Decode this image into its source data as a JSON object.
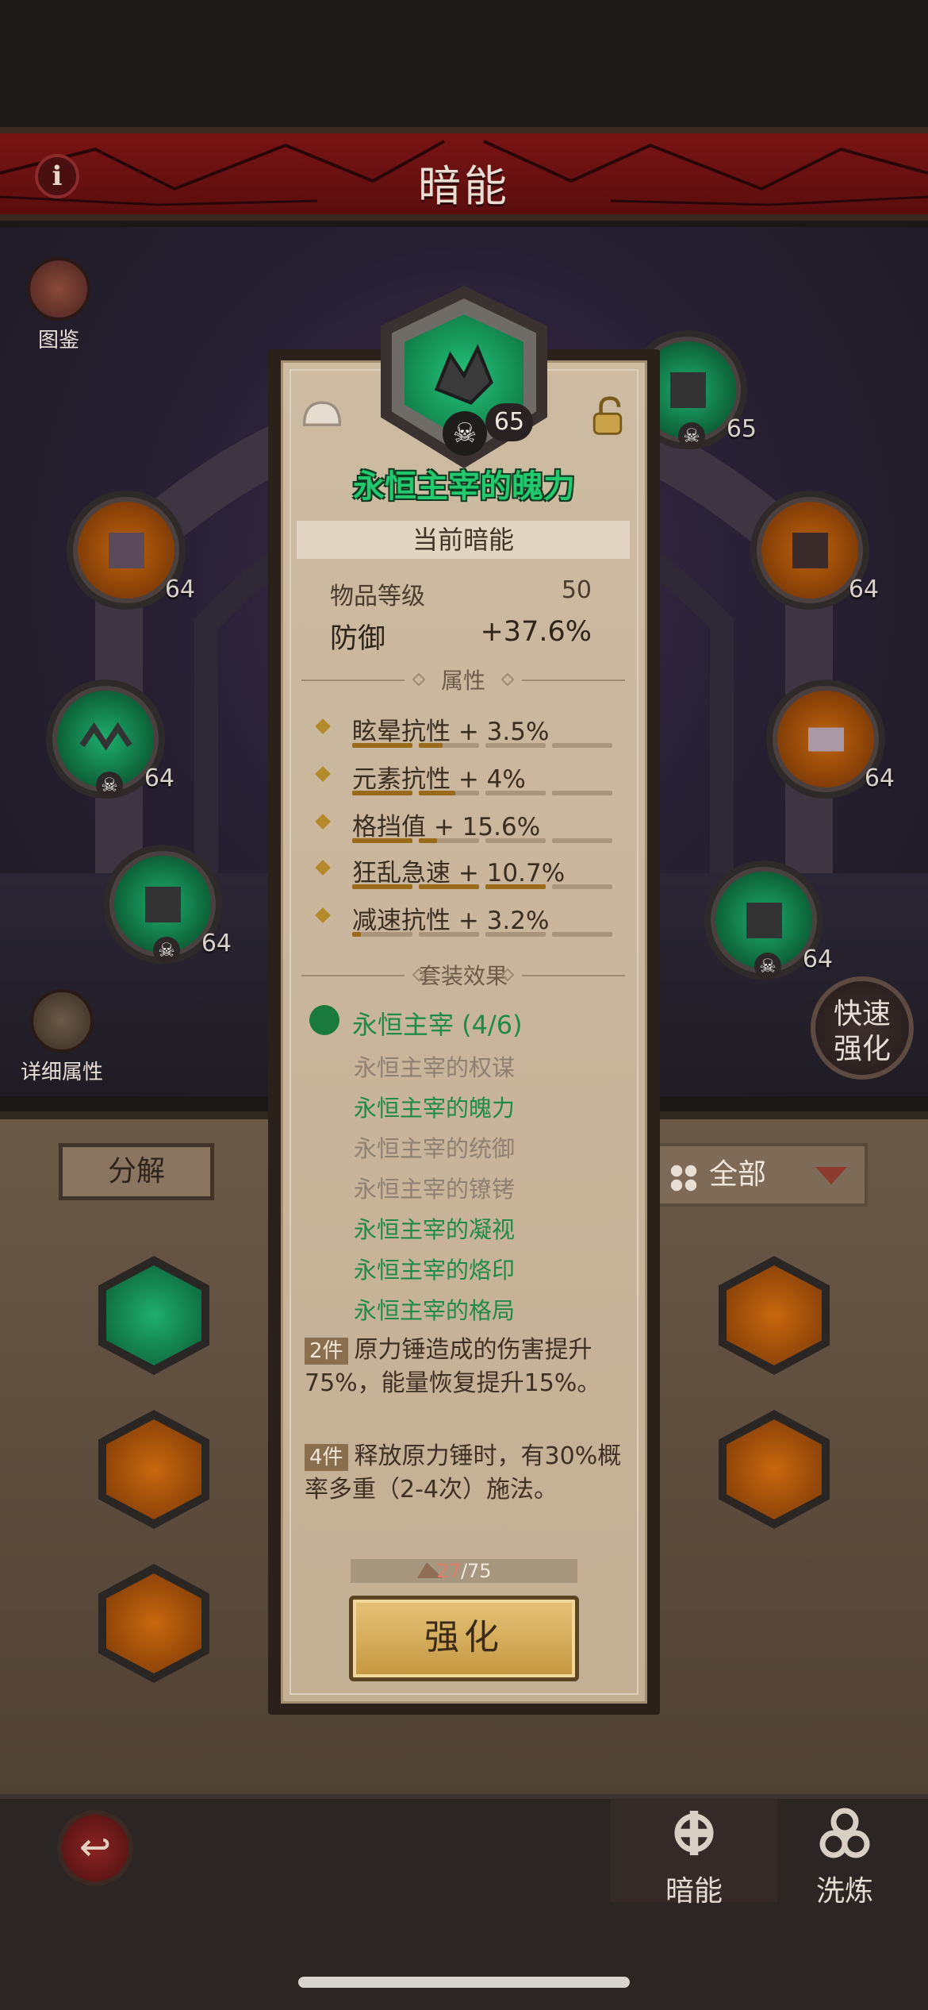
{
  "header": {
    "title": "暗能",
    "info_icon": "info-icon"
  },
  "side": {
    "codex_label": "图鉴",
    "details_label": "详细属性",
    "quick_upgrade_label": "快速\n强化"
  },
  "equip_slots": [
    {
      "level": "64",
      "rarity": "orange"
    },
    {
      "level": "64",
      "rarity": "green"
    },
    {
      "level": "64",
      "rarity": "green"
    },
    {
      "level": "64",
      "rarity": "orange"
    },
    {
      "level": "64",
      "rarity": "orange"
    },
    {
      "level": "64",
      "rarity": "green"
    },
    {
      "level": "65",
      "rarity": "green"
    }
  ],
  "inventory": {
    "decompose_label": "分解",
    "filter_label": "全部"
  },
  "popup": {
    "level": "65",
    "item_name": "永恒主宰的魄力",
    "section_title": "当前暗能",
    "item_level_label": "物品等级",
    "item_level_value": "50",
    "main_stat_label": "防御",
    "main_stat_value": "+37.6%",
    "attributes_header": "属性",
    "attributes": [
      {
        "text": "眩晕抗性 + 3.5%",
        "fills": [
          1,
          0.4,
          0,
          0
        ]
      },
      {
        "text": "元素抗性 + 4%",
        "fills": [
          1,
          0.6,
          0,
          0
        ]
      },
      {
        "text": "格挡值 + 15.6%",
        "fills": [
          1,
          0.3,
          0,
          0
        ]
      },
      {
        "text": "狂乱急速 + 10.7%",
        "fills": [
          1,
          1,
          1,
          0
        ]
      },
      {
        "text": "减速抗性 + 3.2%",
        "fills": [
          0.15,
          0,
          0,
          0
        ]
      }
    ],
    "set_header": "套装效果",
    "set_name": "永恒主宰 (4/6)",
    "set_pieces": [
      {
        "name": "永恒主宰的权谋",
        "owned": false
      },
      {
        "name": "永恒主宰的魄力",
        "owned": true
      },
      {
        "name": "永恒主宰的统御",
        "owned": false
      },
      {
        "name": "永恒主宰的镣铐",
        "owned": false
      },
      {
        "name": "永恒主宰的凝视",
        "owned": true
      },
      {
        "name": "永恒主宰的烙印",
        "owned": true
      },
      {
        "name": "永恒主宰的格局",
        "owned": true
      }
    ],
    "bonus_2_tag": "2件",
    "bonus_2_text": "原力锤造成的伤害提升75%，能量恢复提升15%。",
    "bonus_4_tag": "4件",
    "bonus_4_text": "释放原力锤时，有30%概率多重（2-4次）施法。",
    "cost_have": "27",
    "cost_need": "/75",
    "upgrade_label": "强化"
  },
  "tabs": [
    {
      "label": "暗能",
      "icon": "dark-energy-icon",
      "active": true
    },
    {
      "label": "洗炼",
      "icon": "refine-icon",
      "active": false
    }
  ],
  "colors": {
    "set_active": "#1f8a49",
    "set_inactive": "#8e8172",
    "title_bar": "#7a1414",
    "item_name": "#22c96e"
  }
}
